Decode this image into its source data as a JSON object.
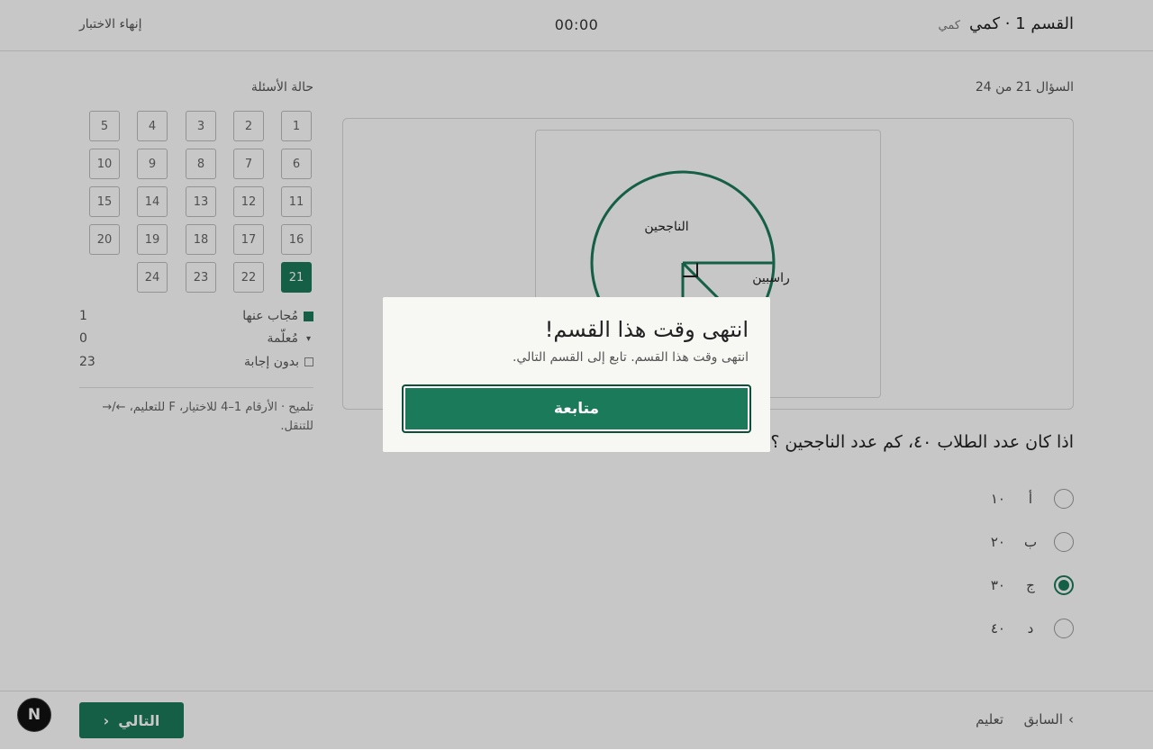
{
  "header": {
    "title": "القسم 1 · كمي",
    "subtitle": "كمي",
    "timer": "00:00",
    "end_exam": "إنهاء الاختبار"
  },
  "question": {
    "progress": "السؤال 21 من 24",
    "text": "اذا كان عدد الطلاب ٤٠، كم عدد الناجحين ؟",
    "figure_labels": {
      "passed": "الناجحين",
      "failed": "راسبين"
    },
    "options": [
      {
        "letter": "أ",
        "value": "١٠",
        "selected": false
      },
      {
        "letter": "ب",
        "value": "٢٠",
        "selected": false
      },
      {
        "letter": "ج",
        "value": "٣٠",
        "selected": true
      },
      {
        "letter": "د",
        "value": "٤٠",
        "selected": false
      }
    ]
  },
  "side_panel": {
    "title": "حالة الأسئلة",
    "question_numbers": [
      "1",
      "2",
      "3",
      "4",
      "5",
      "6",
      "7",
      "8",
      "9",
      "10",
      "11",
      "12",
      "13",
      "14",
      "15",
      "16",
      "17",
      "18",
      "19",
      "20",
      "21",
      "22",
      "23",
      "24"
    ],
    "current_question": "21",
    "legend": {
      "answered_label": "مُجاب عنها",
      "answered_count": "1",
      "flagged_label": "مُعلّمة",
      "flagged_count": "0",
      "unanswered_label": "بدون إجابة",
      "unanswered_count": "23"
    },
    "hint": "تلميح · الأرقام 1–4 للاختيار، F للتعليم، ←/→ للتنقل."
  },
  "footer": {
    "next_label": "التالي",
    "prev_label": "السابق",
    "teach_label": "تعليم",
    "avatar_letter": "N"
  },
  "modal": {
    "title": "انتهى وقت هذا القسم!",
    "text": "انتهى وقت هذا القسم. تابع إلى القسم التالي.",
    "continue_label": "متابعة"
  },
  "colors": {
    "accent": "#1a7a5a",
    "overlay": "rgba(0,0,0,0.22)"
  }
}
